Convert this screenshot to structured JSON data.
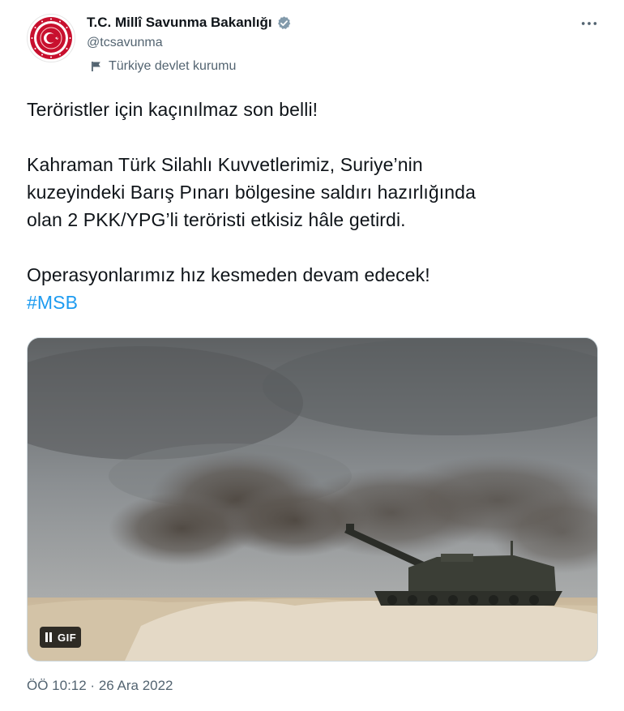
{
  "author": {
    "display_name": "T.C. Millî Savunma Bakanlığı",
    "handle": "@tcsavunma",
    "label": "Türkiye devlet kurumu",
    "avatar_icon": "ministry-emblem-icon",
    "verified_icon": "verified-badge-icon"
  },
  "tweet": {
    "line1": "Teröristler için kaçınılmaz son belli!",
    "line2": "Kahraman Türk Silahlı Kuvvetlerimiz, Suriye’nin\nkuzeyindeki Barış Pınarı bölgesine saldırı hazırlığında\nolan 2 PKK/YPG’li teröristi etkisiz hâle getirdi.",
    "line3": "Operasyonlarımız hız kesmeden devam edecek!",
    "hashtag": "#MSB"
  },
  "media": {
    "type": "gif",
    "gif_label": "GIF",
    "pause_icon": "pause-icon"
  },
  "timestamp": "ÖÖ 10:12 · 26 Ara 2022",
  "colors": {
    "link": "#1d9bf0",
    "secondary_text": "#536471",
    "verified": "#829aab",
    "emblem_red": "#c8102e"
  }
}
